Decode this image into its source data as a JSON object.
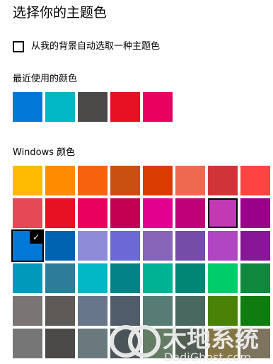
{
  "title": "选择你的主题色",
  "auto_pick": {
    "label": "从我的背景自动选取一种主题色",
    "checked": false
  },
  "recent": {
    "label": "最近使用的颜色",
    "colors": [
      "#0078D7",
      "#00B7C3",
      "#4C4A48",
      "#E81123",
      "#EA005E"
    ]
  },
  "windows": {
    "label": "Windows 颜色",
    "selected_index": 16,
    "hover_index": 14,
    "colors": [
      "#FFB900",
      "#FF8C00",
      "#F7630C",
      "#CA5010",
      "#DA3B01",
      "#EF6950",
      "#D13438",
      "#FF4343",
      "#E74856",
      "#E81123",
      "#EA005E",
      "#C30052",
      "#E3008C",
      "#BF0077",
      "#C239B3",
      "#9A0089",
      "#0078D7",
      "#0063B1",
      "#8E8CD8",
      "#6B69D6",
      "#8764B8",
      "#744DA9",
      "#B146C2",
      "#881798",
      "#0099BC",
      "#2D7D9A",
      "#00B7C3",
      "#038387",
      "#00B294",
      "#018574",
      "#00CC6A",
      "#10893E",
      "#7A7574",
      "#5D5A58",
      "#68768A",
      "#515C6B",
      "#567C73",
      "#486860",
      "#498205",
      "#107C10",
      "#767676",
      "#4C4A48",
      "#69797E",
      "#4A5459",
      "#647C64",
      "#525E54",
      "#847545",
      "#7E735F"
    ]
  },
  "check_glyph": "✓",
  "watermark": {
    "brand": "大地系统",
    "site": "DadiGhost.com",
    "color": "#e6e6e6"
  }
}
